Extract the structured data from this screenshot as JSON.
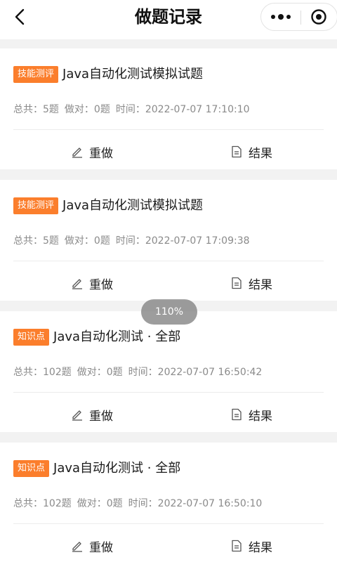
{
  "nav": {
    "title": "做题记录",
    "back_icon": "chevron-left-icon",
    "more_icon": "more-dots-icon",
    "close_icon": "target-circle-icon"
  },
  "records": [
    {
      "tag": "技能测评",
      "title": "Java自动化测试模拟试题",
      "total": "总共：5题",
      "correct": "做对：0题",
      "time": "时间：2022-07-07 17:10:10",
      "redo_label": "重做",
      "result_label": "结果"
    },
    {
      "tag": "技能测评",
      "title": "Java自动化测试模拟试题",
      "total": "总共：5题",
      "correct": "做对：0题",
      "time": "时间：2022-07-07 17:09:38",
      "redo_label": "重做",
      "result_label": "结果"
    },
    {
      "tag": "知识点",
      "title": "Java自动化测试 · 全部",
      "total": "总共：102题",
      "correct": "做对：0题",
      "time": "时间：2022-07-07 16:50:42",
      "redo_label": "重做",
      "result_label": "结果"
    },
    {
      "tag": "知识点",
      "title": "Java自动化测试 · 全部",
      "total": "总共：102题",
      "correct": "做对：0题",
      "time": "时间：2022-07-07 16:50:10",
      "redo_label": "重做",
      "result_label": "结果"
    }
  ],
  "zoom": "110%",
  "colors": {
    "tag_bg": "#fb7e2c",
    "meta_text": "#8a8a8a",
    "background": "#f2f2f2"
  }
}
